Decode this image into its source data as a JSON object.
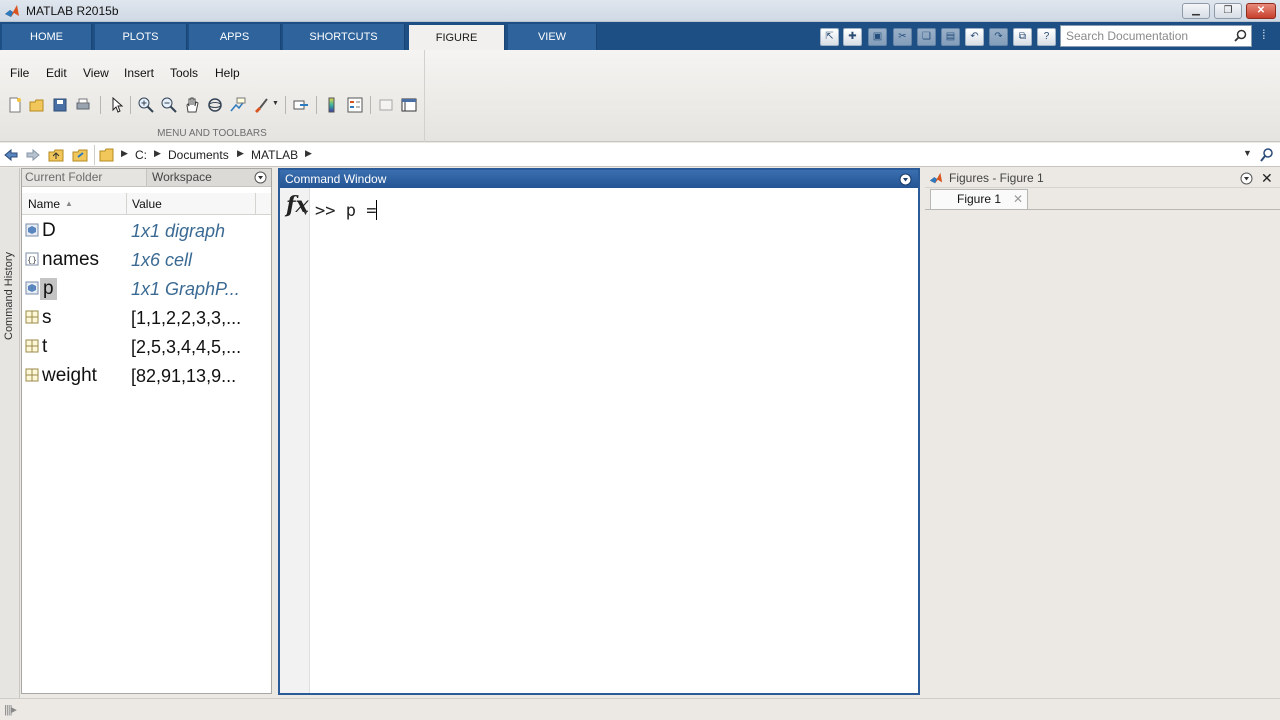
{
  "window": {
    "title": "MATLAB R2015b"
  },
  "ribbon": {
    "tabs": [
      {
        "label": "HOME",
        "active": false
      },
      {
        "label": "PLOTS",
        "active": false
      },
      {
        "label": "APPS",
        "active": false
      },
      {
        "label": "SHORTCUTS",
        "active": false
      },
      {
        "label": "FIGURE",
        "active": true
      },
      {
        "label": "VIEW",
        "active": false
      }
    ],
    "search_placeholder": "Search Documentation",
    "menu": [
      "File",
      "Edit",
      "View",
      "Insert",
      "Tools",
      "Help"
    ],
    "group_label": "MENU AND TOOLBARS",
    "toolbar_icons": [
      "new-figure-icon",
      "open-icon",
      "save-icon",
      "print-icon",
      "select-arrow-icon",
      "zoom-in-icon",
      "zoom-out-icon",
      "pan-icon",
      "rotate-3d-icon",
      "data-cursor-icon",
      "brush-icon",
      "link-plot-icon",
      "colorbar-icon",
      "legend-icon",
      "hide-plot-tools-icon",
      "show-plot-tools-icon"
    ],
    "quick_access_icons": [
      "pin-icon",
      "new-icon",
      "save-icon",
      "cut-icon",
      "copy-icon",
      "paste-icon",
      "undo-icon",
      "redo-icon",
      "switch-windows-icon",
      "help-icon"
    ]
  },
  "address": {
    "crumbs": [
      "C:",
      "Documents",
      "MATLAB"
    ]
  },
  "side_strip": {
    "label": "Command History"
  },
  "workspace": {
    "tabs": [
      "Current Folder",
      "Workspace"
    ],
    "columns": [
      "Name",
      "Value"
    ],
    "rows": [
      {
        "name": "D",
        "value": "1x1 digraph",
        "kind": "object",
        "selected": false
      },
      {
        "name": "names",
        "value": "1x6 cell",
        "kind": "cell",
        "selected": false
      },
      {
        "name": "p",
        "value": "1x1 GraphP...",
        "kind": "object",
        "selected": true
      },
      {
        "name": "s",
        "value": "[1,1,2,2,3,3,...",
        "kind": "matrix",
        "selected": false
      },
      {
        "name": "t",
        "value": "[2,5,3,4,4,5,...",
        "kind": "matrix",
        "selected": false
      },
      {
        "name": "weight",
        "value": "[82,91,13,9...",
        "kind": "matrix",
        "selected": false
      }
    ]
  },
  "command_window": {
    "title": "Command Window",
    "fx_label": "fx",
    "prompt": ">>",
    "input": "p ="
  },
  "figures": {
    "title": "Figures - Figure 1",
    "tab": "Figure 1",
    "tab_close": "✕"
  },
  "colors": {
    "tab_bar": "#1d4f85",
    "command_window_border": "#2a5b98",
    "object_value_text": "#3a6a93"
  }
}
